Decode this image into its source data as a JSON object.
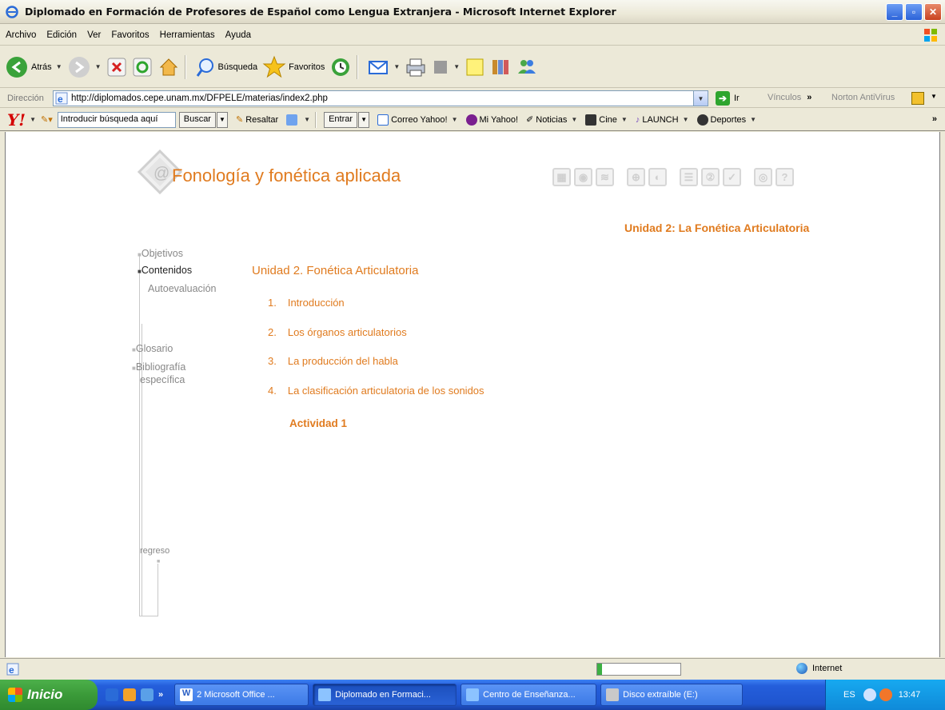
{
  "window": {
    "title": "Diplomado en Formación de Profesores de Español como Lengua Extranjera - Microsoft Internet Explorer",
    "min": "_",
    "max": "▫",
    "close": "✕"
  },
  "menu": {
    "items": [
      "Archivo",
      "Edición",
      "Ver",
      "Favoritos",
      "Herramientas",
      "Ayuda"
    ]
  },
  "toolbar": {
    "back": "Atrás",
    "search": "Búsqueda",
    "favorites": "Favoritos"
  },
  "address": {
    "label": "Dirección",
    "url": "http://diplomados.cepe.unam.mx/DFPELE/materias/index2.php",
    "go": "Ir",
    "links": "Vínculos",
    "links_more": "»",
    "norton": "Norton AntiVirus"
  },
  "yahoo": {
    "logo": "Y!",
    "search_placeholder": "Introducir búsqueda aquí",
    "buscar": "Buscar",
    "resaltar": "Resaltar",
    "entrar": "Entrar",
    "items": [
      "Correo Yahoo!",
      "Mi Yahoo!",
      "Noticias",
      "Cine",
      "LAUNCH",
      "Deportes"
    ],
    "more": "»"
  },
  "page": {
    "course_title": "Fonología y fonética aplicada",
    "unit_heading": "Unidad 2: La Fonética Articulatoria",
    "nav": {
      "objetivos": "Objetivos",
      "contenidos": "Contenidos",
      "autoevaluacion": "Autoevaluación",
      "glosario": "Glosario",
      "bibliografia_1": "Bibliografía",
      "bibliografia_2": "específica",
      "regreso": "regreso"
    },
    "section_title": "Unidad 2. Fonética Articulatoria",
    "toc": [
      {
        "num": "1.",
        "label": "Introducción"
      },
      {
        "num": "2.",
        "label": "Los órganos articulatorios"
      },
      {
        "num": "3.",
        "label": "La producción del habla"
      },
      {
        "num": "4.",
        "label": "La clasificación articulatoria de los sonidos"
      }
    ],
    "activity": "Actividad 1"
  },
  "status": {
    "zone": "Internet"
  },
  "taskbar": {
    "start": "Inicio",
    "tasks": [
      {
        "label": "2 Microsoft Office ..."
      },
      {
        "label": "Diplomado en Formaci..."
      },
      {
        "label": "Centro de Enseñanza..."
      },
      {
        "label": "Disco extraíble (E:)"
      }
    ],
    "lang": "ES",
    "clock": "13:47"
  },
  "colors": {
    "accent_orange": "#e07b1f",
    "nav_gray": "#888888",
    "xp_blue": "#245edb"
  }
}
